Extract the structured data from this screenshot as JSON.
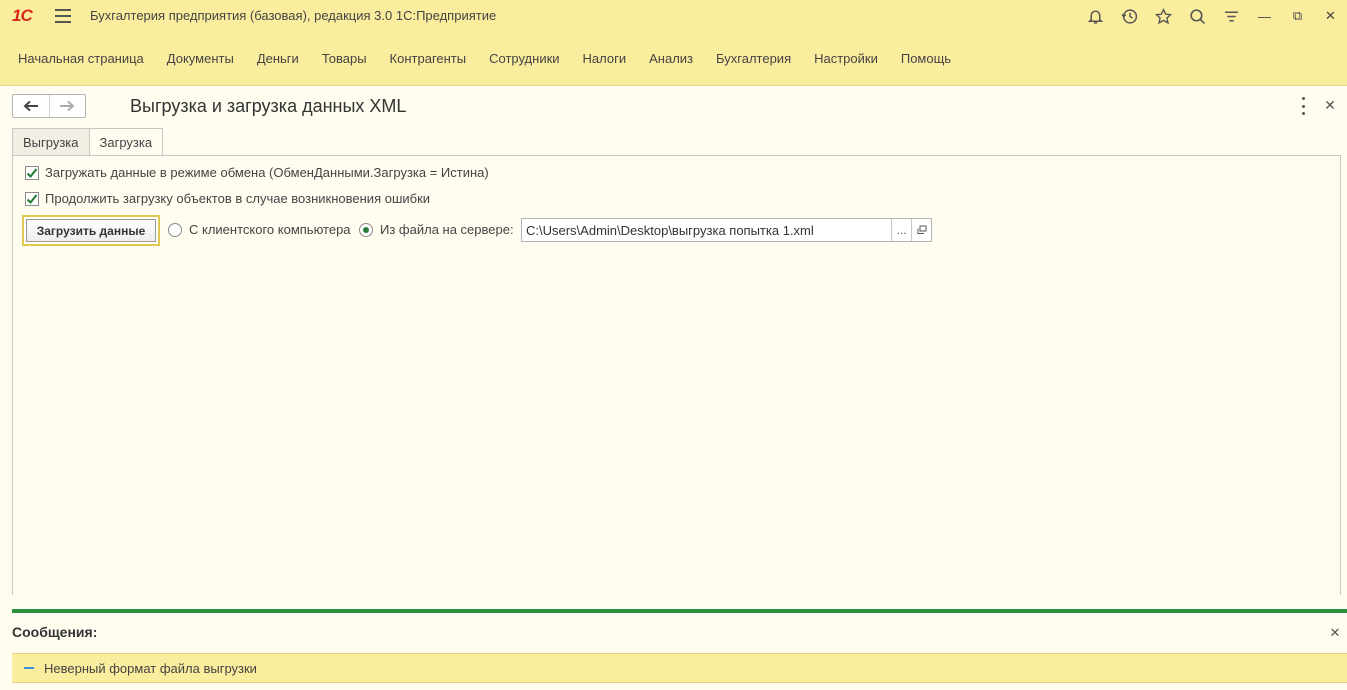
{
  "titlebar": {
    "logo_text": "1С",
    "app_title": "Бухгалтерия предприятия (базовая), редакция 3.0 1С:Предприятие",
    "icons": [
      "bell-icon",
      "history-icon",
      "star-icon",
      "search-icon",
      "menu-lines-icon"
    ],
    "window_buttons": {
      "minimize": "—",
      "restore": "⧉",
      "close": "✕"
    }
  },
  "sections": [
    "Начальная страница",
    "Документы",
    "Деньги",
    "Товары",
    "Контрагенты",
    "Сотрудники",
    "Налоги",
    "Анализ",
    "Бухгалтерия",
    "Настройки",
    "Помощь"
  ],
  "form": {
    "title": "Выгрузка и загрузка данных XML",
    "close_glyph": "✕",
    "tabs": [
      {
        "label": "Выгрузка",
        "active": false
      },
      {
        "label": "Загрузка",
        "active": true
      }
    ],
    "checkboxes": [
      {
        "label": "Загружать данные в режиме обмена (ОбменДанными.Загрузка = Истина)",
        "checked": true
      },
      {
        "label": "Продолжить загрузку объектов в случае возникновения ошибки",
        "checked": true
      }
    ],
    "load_button": "Загрузить данные",
    "radios": [
      {
        "label": "С клиентского компьютера",
        "selected": false
      },
      {
        "label": "Из файла на сервере:",
        "selected": true
      }
    ],
    "path_value": "C:\\Users\\Admin\\Desktop\\выгрузка попытка 1.xml",
    "path_select_glyph": "...",
    "path_open_icon": "open-window-icon"
  },
  "messages": {
    "title": "Сообщения:",
    "close_glyph": "✕",
    "items": [
      "Неверный формат файла выгрузки"
    ]
  },
  "colors": {
    "header_bg": "#fbed9e",
    "page_bg": "#fffdf0",
    "accent_green": "#2a8f3e",
    "logo_red": "#d5271b"
  }
}
